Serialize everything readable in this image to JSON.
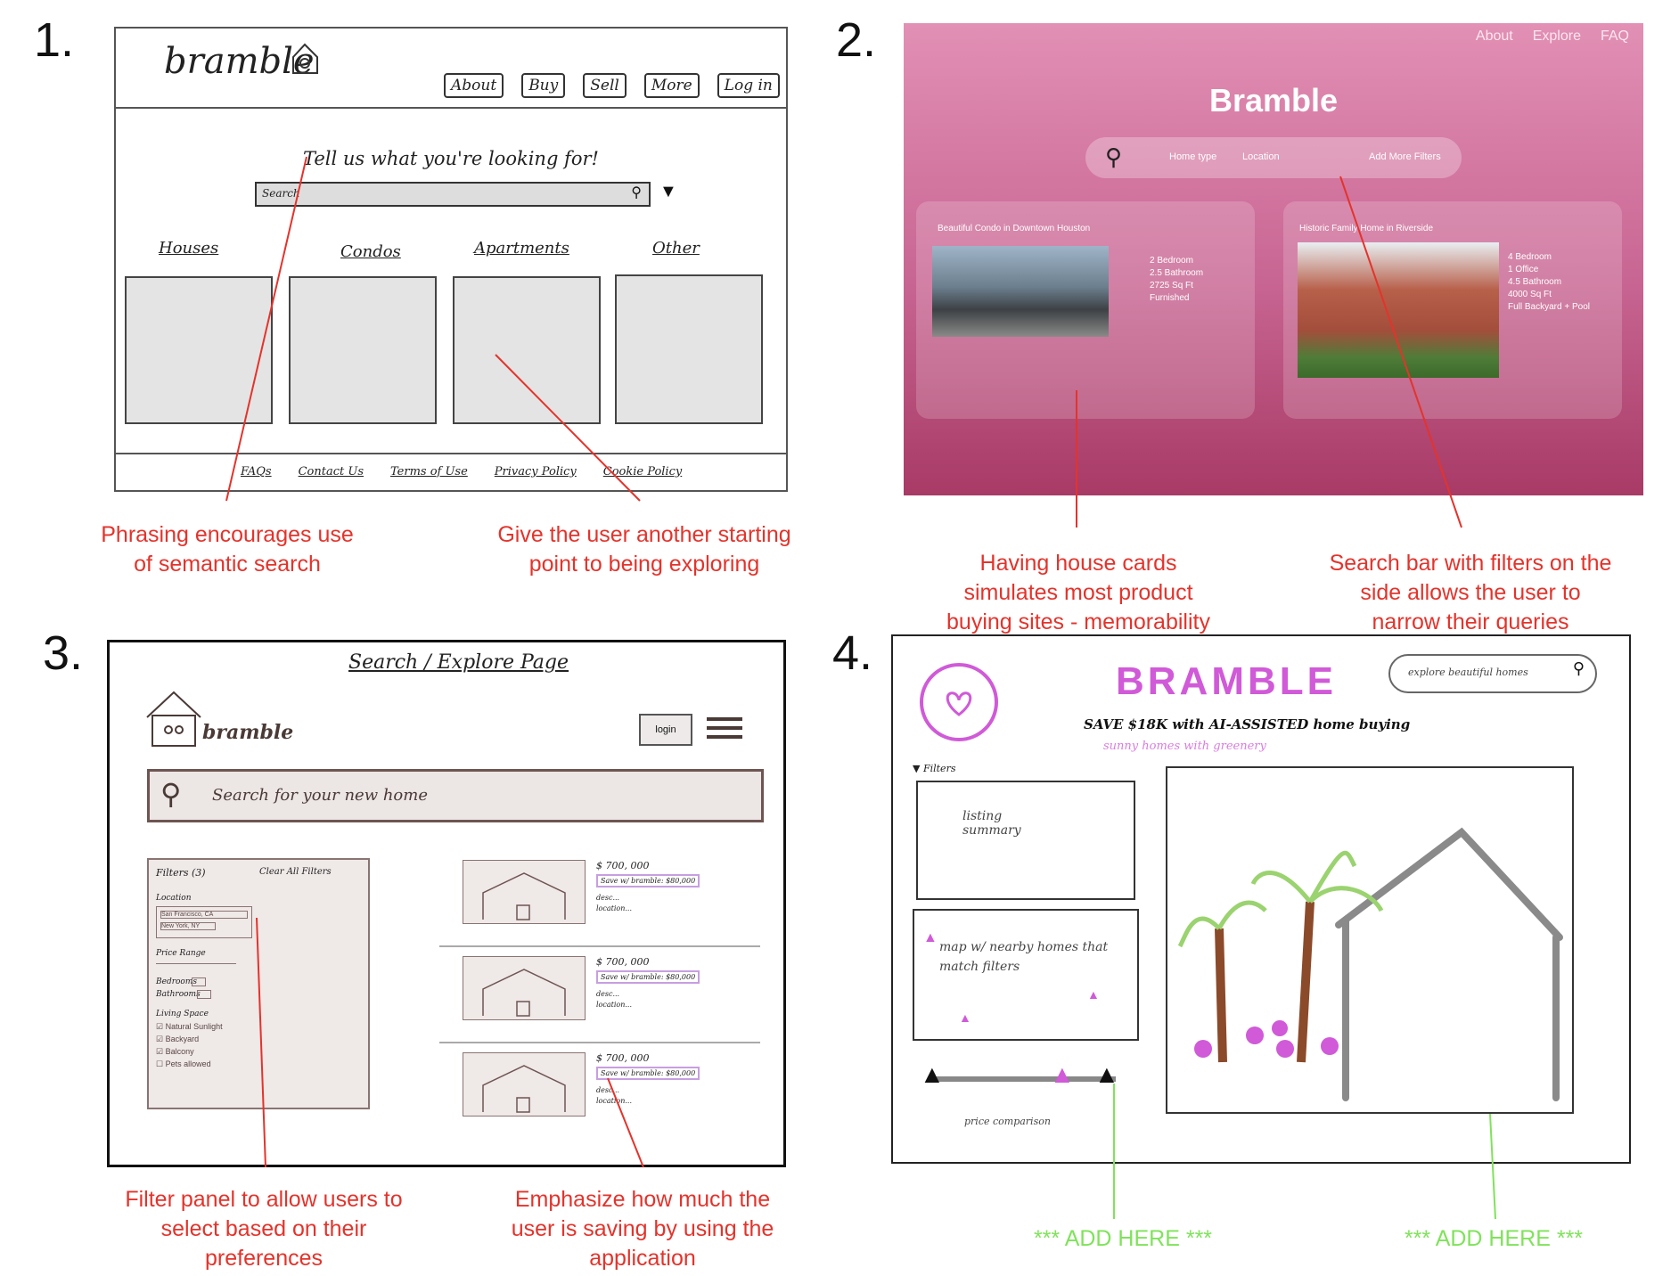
{
  "panel_numbers": [
    "1.",
    "2.",
    "3.",
    "4."
  ],
  "panel1": {
    "logo": "bramble",
    "nav": [
      "About",
      "Buy",
      "Sell",
      "More",
      "Log in"
    ],
    "prompt": "Tell us what you're looking for!",
    "search_placeholder": "Search",
    "categories": [
      "Houses",
      "Condos",
      "Apartments",
      "Other"
    ],
    "footer": [
      "FAQs",
      "Contact Us",
      "Terms of Use",
      "Privacy Policy",
      "Cookie Policy"
    ],
    "notes": [
      "Phrasing encourages use of semantic search",
      "Give the user another starting point to being exploring"
    ]
  },
  "panel2": {
    "nav": [
      "About",
      "Explore",
      "FAQ"
    ],
    "title": "Bramble",
    "search_fields": [
      "Home type",
      "Location",
      "Add More Filters"
    ],
    "cards": [
      {
        "title": "Beautiful Condo in Downtown Houston",
        "details": [
          "2 Bedroom",
          "2.5 Bathroom",
          "2725 Sq Ft",
          "Furnished"
        ]
      },
      {
        "title": "Historic Family Home in Riverside",
        "details": [
          "4 Bedroom",
          "1 Office",
          "4.5 Bathroom",
          "4000 Sq Ft",
          "Full Backyard + Pool"
        ]
      }
    ],
    "notes": [
      "Having house cards simulates most product buying sites - memorability",
      "Search bar with filters on the side allows the user to narrow their queries"
    ]
  },
  "panel3": {
    "page_title": "Search / Explore Page",
    "logo": "bramble",
    "login": "login",
    "search_placeholder": "Search for your new home",
    "filters_title": "Filters (3)",
    "clear_filters": "Clear All Filters",
    "location_label": "Location",
    "locations": [
      "San Francisco, CA",
      "New York, NY"
    ],
    "price_label": "Price Range",
    "bedrooms_label": "Bedrooms",
    "bathrooms_label": "Bathrooms",
    "living_label": "Living Space",
    "living_options": [
      "Natural Sunlight",
      "Backyard",
      "Balcony",
      "Pets allowed"
    ],
    "listings": [
      {
        "price": "$ 700, 000",
        "save": "Save w/ bramble: $80,000",
        "desc": "desc...",
        "loc": "location..."
      },
      {
        "price": "$ 700, 000",
        "save": "Save w/ bramble: $80,000",
        "desc": "desc...",
        "loc": "location..."
      },
      {
        "price": "$ 700, 000",
        "save": "Save w/ bramble: $80,000",
        "desc": "desc...",
        "loc": "location..."
      }
    ],
    "notes": [
      "Filter panel to allow users to select based on their preferences",
      "Emphasize how much the user is saving by using the application"
    ]
  },
  "panel4": {
    "title": "BRAMBLE",
    "search_placeholder": "explore beautiful homes",
    "tagline": "SAVE $18K with AI-ASSISTED home buying",
    "subtag": "sunny homes with greenery",
    "filters_label": "Filters",
    "summary": "listing summary",
    "map_text": "map w/ nearby homes that match filters",
    "price_comparison": "price comparison",
    "add_here": [
      "*** ADD HERE ***",
      "*** ADD HERE ***"
    ]
  },
  "colors": {
    "annotation": "#e4332b",
    "green_note": "#7fe35a",
    "bramble_pink": "#c86592",
    "purple": "#d05ad8"
  }
}
